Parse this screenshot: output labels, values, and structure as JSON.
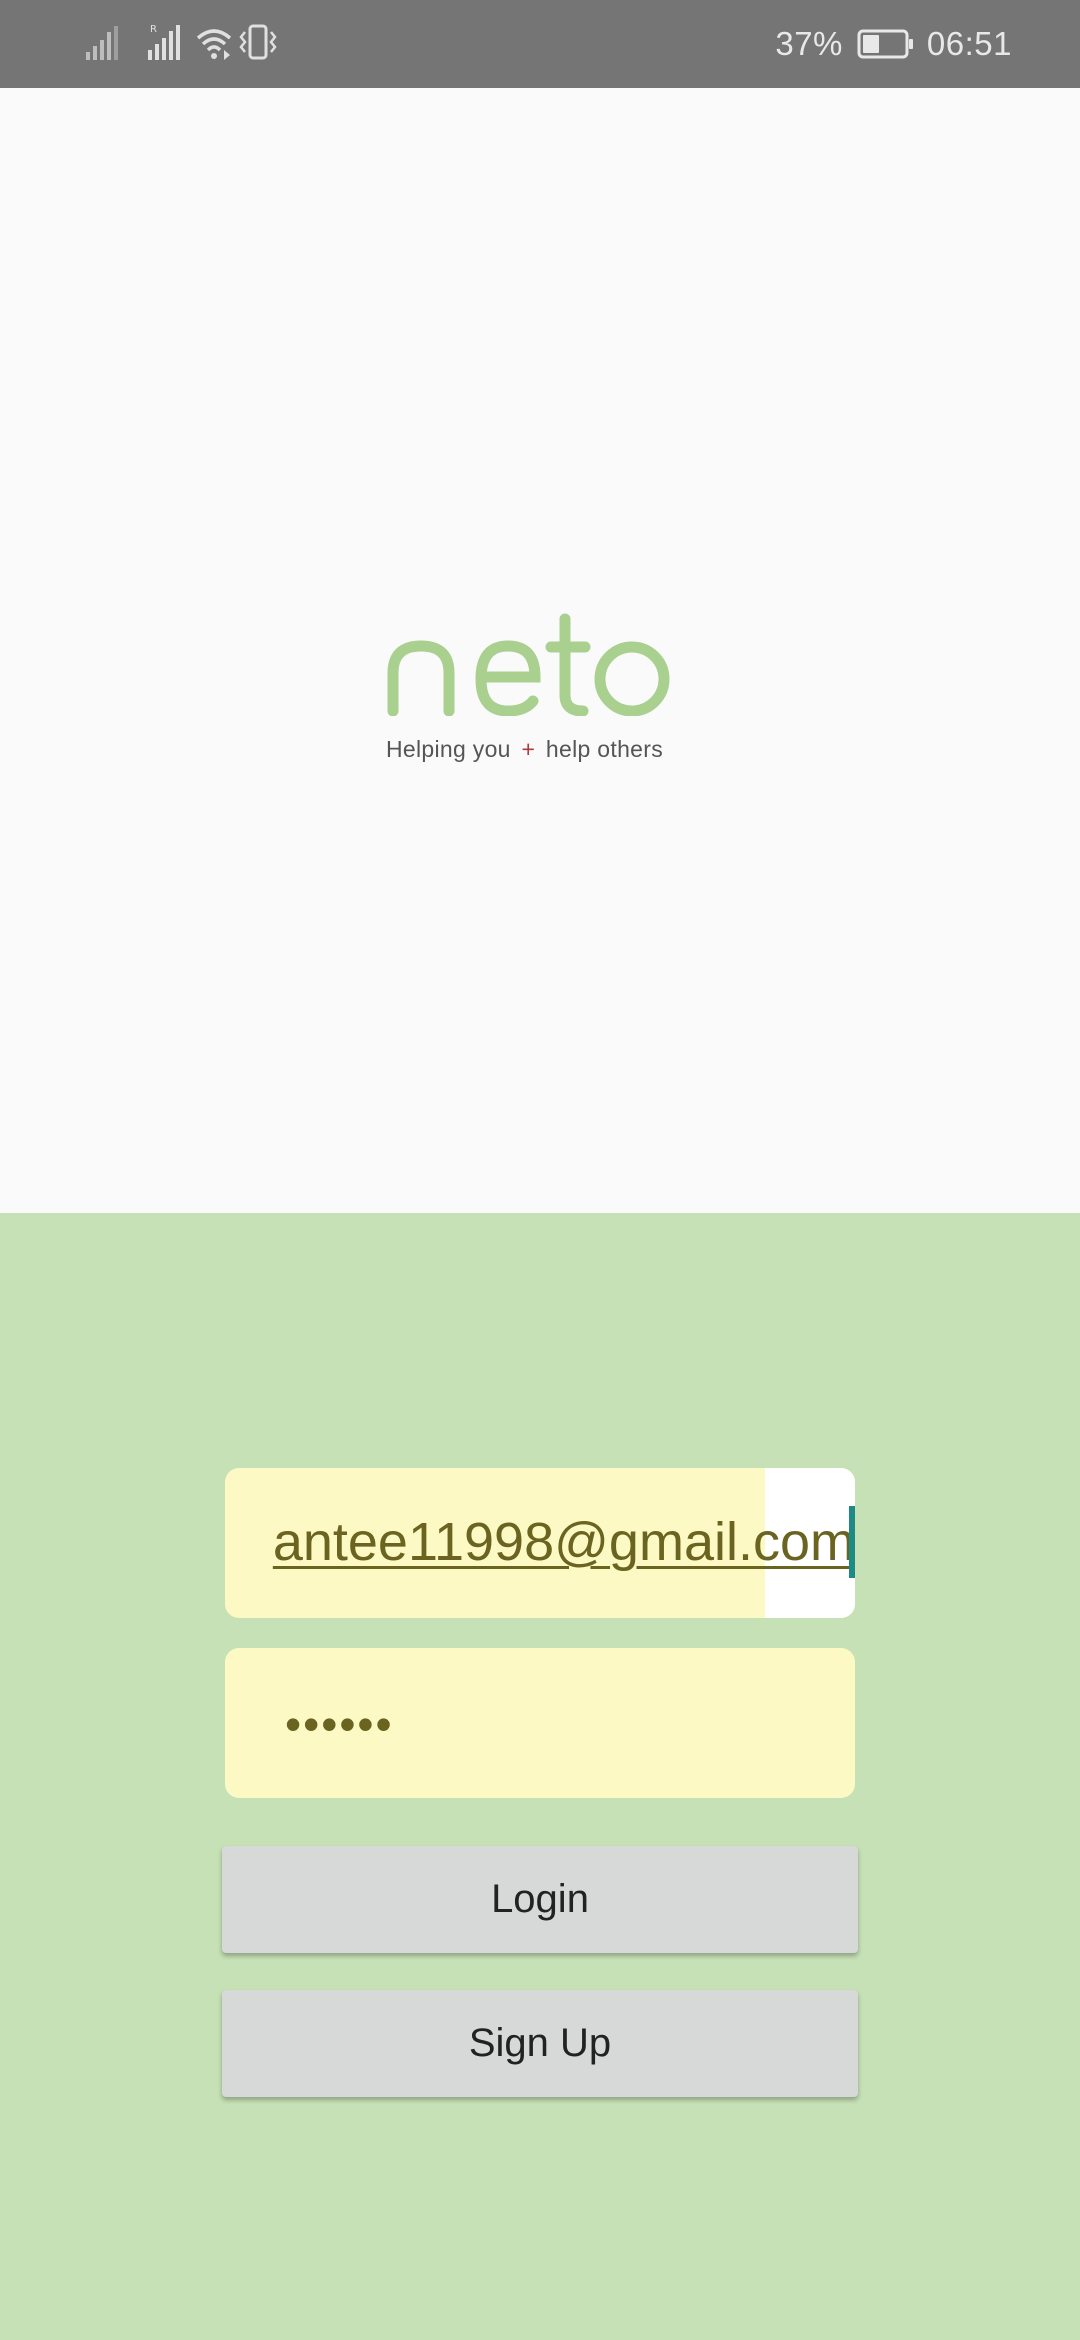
{
  "status_bar": {
    "battery_percent": "37%",
    "time": "06:51",
    "icons": [
      "signal-icon",
      "signal-roaming-icon",
      "wifi-icon",
      "vibrate-icon",
      "battery-icon"
    ]
  },
  "logo": {
    "wordmark": "neto",
    "tagline_part1": "Helping you",
    "tagline_plus": "+",
    "tagline_part2": "help others",
    "brand_color": "#a9d08e"
  },
  "form": {
    "email_value": "antee11998@gmail.com",
    "password_value": "••••••",
    "login_label": "Login",
    "signup_label": "Sign Up"
  },
  "colors": {
    "status_bar_bg": "#757575",
    "logo_bg": "#fafafa",
    "form_bg": "#c5e1b5",
    "field_autofill_bg": "#fdf9c5",
    "button_bg": "#d7d9d8",
    "cursor": "#1e8a84"
  }
}
